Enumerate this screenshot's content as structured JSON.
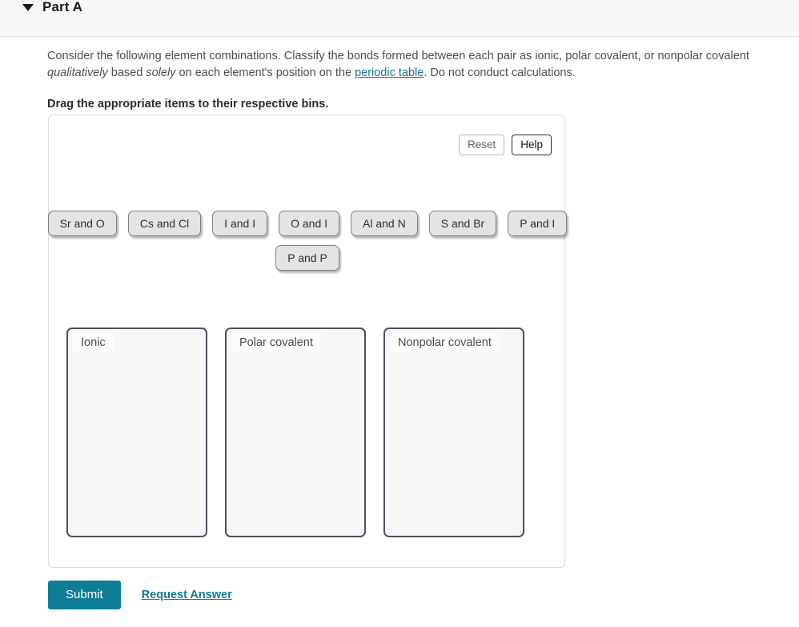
{
  "header": {
    "title": "Part A",
    "disclosure_icon": "triangle-down-icon"
  },
  "prompt": {
    "segment_1": "Consider the following element combinations. Classify the bonds formed between each pair as ionic, polar covalent, or nonpolar covalent ",
    "italic_1": "qualitatively",
    "segment_2": " based ",
    "italic_2": "solely",
    "segment_3": " on each element's position on the ",
    "link_text": "periodic table",
    "segment_4": ". Do not conduct calculations.",
    "instruction": "Drag the appropriate items to their respective bins."
  },
  "toolbar": {
    "reset_label": "Reset",
    "help_label": "Help"
  },
  "tiles": {
    "row_1": [
      {
        "label": "Sr and O"
      },
      {
        "label": "Cs and Cl"
      },
      {
        "label": "I and I"
      },
      {
        "label": "O and I"
      },
      {
        "label": "Al and N"
      },
      {
        "label": "S and Br"
      },
      {
        "label": "P and I"
      }
    ],
    "row_2": [
      {
        "label": "P and P"
      }
    ]
  },
  "bins": [
    {
      "label": "Ionic",
      "items": []
    },
    {
      "label": "Polar covalent",
      "items": []
    },
    {
      "label": "Nonpolar covalent",
      "items": []
    }
  ],
  "footer": {
    "submit_label": "Submit",
    "request_answer_label": "Request Answer"
  },
  "colors": {
    "accent_teal": "#0d7c96",
    "link_teal": "#17748c",
    "tile_fill": "#e4e4e4",
    "tile_border": "#7b7f8a",
    "bin_border": "#4e4f60",
    "bin_fill": "#f7f7f7",
    "header_bar": "#f7f7f7"
  }
}
